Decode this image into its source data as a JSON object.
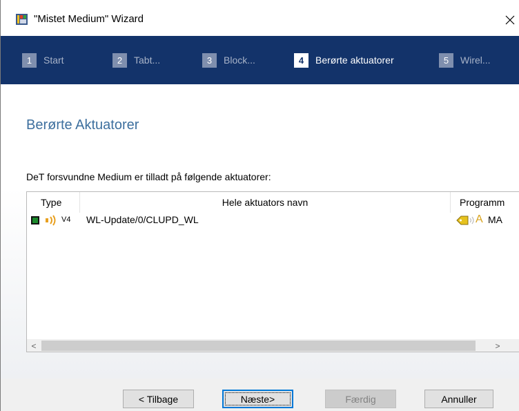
{
  "window": {
    "title": "\"Mistet Medium\" Wizard",
    "close_glyph": "✕"
  },
  "steps": [
    {
      "number": "1",
      "label": "Start"
    },
    {
      "number": "2",
      "label": "Tabt..."
    },
    {
      "number": "3",
      "label": "Block..."
    },
    {
      "number": "4",
      "label": "Berørte aktuatorer",
      "active": true
    },
    {
      "number": "5",
      "label": "Wirel..."
    }
  ],
  "page": {
    "title": "Berørte Aktuatorer",
    "info": "DeT forsvundne Medium er tilladt på følgende aktuatorer:"
  },
  "table": {
    "columns": [
      "Type",
      "Hele aktuators navn",
      "Programm"
    ],
    "rows": [
      {
        "type_version": "V4",
        "type_icons": [
          "green-square-icon",
          "sound-wave-icon"
        ],
        "name": "WL-Update/0/CLUPD_WL",
        "prog_icons": [
          "transponder-tag-icon",
          "wireless-icon",
          "letter-a-icon"
        ],
        "prog_letter": "A",
        "prog_text": "MA"
      }
    ]
  },
  "scrollbar": {
    "left_glyph": "<",
    "right_glyph": ">"
  },
  "buttons": {
    "back": "< Tilbage",
    "next": "Næste>",
    "finish": "Færdig",
    "cancel": "Annuller"
  },
  "colors": {
    "step_bar": "#13336a",
    "page_title": "#3d6f9e",
    "accent_focus": "#0078d7"
  }
}
